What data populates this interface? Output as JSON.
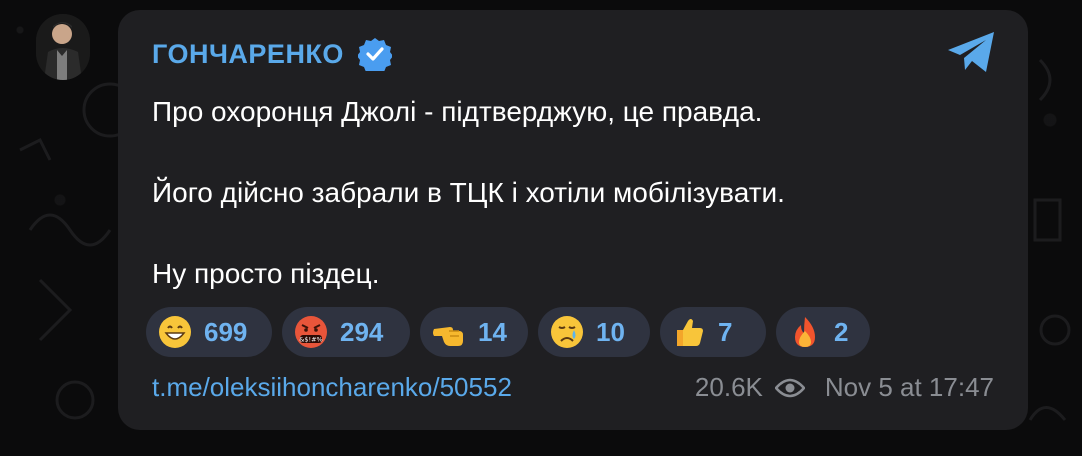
{
  "post": {
    "channel_name": "ГОНЧАРЕНКО",
    "verified": true,
    "paragraphs": [
      "Про охоронця Джолі - підтверджую, це правда.",
      "Його дійсно забрали в ТЦК і хотіли мобілізувати.",
      "Ну просто піздец."
    ],
    "link": "t.me/oleksiihoncharenko/50552",
    "views": "20.6K",
    "timestamp": "Nov 5 at 17:47"
  },
  "reactions": [
    {
      "icon": "grinning-face-icon",
      "count": "699"
    },
    {
      "icon": "cursing-face-icon",
      "count": "294"
    },
    {
      "icon": "pointing-hand-icon",
      "count": "14"
    },
    {
      "icon": "crying-face-icon",
      "count": "10"
    },
    {
      "icon": "thumbs-up-icon",
      "count": "7"
    },
    {
      "icon": "fire-icon",
      "count": "2"
    }
  ],
  "colors": {
    "accent": "#5aa9ea",
    "bubble": "#1f1f22",
    "reaction_bg": "#2f3340",
    "meta": "#8a8d93",
    "background": "#0b0b0c"
  }
}
